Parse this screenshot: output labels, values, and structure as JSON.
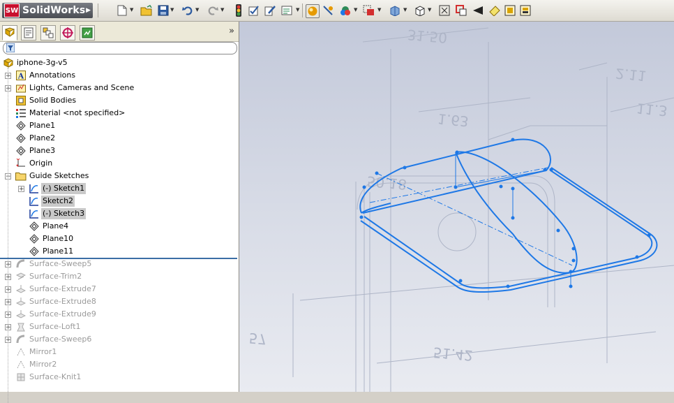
{
  "app": {
    "title": "SolidWorks",
    "logo_mark": "SW"
  },
  "toolbar": {
    "items": [
      "new-document-icon",
      "open-icon",
      "save-icon",
      "undo-icon",
      "redo-icon",
      "rebuild-icon",
      "options-icon",
      "edit-appearance-icon",
      "shaded-icon",
      "view-icon",
      "apply-scene-icon",
      "hide-show-icon",
      "section-view-icon",
      "view-orientation-icon",
      "zoom-to-fit-icon",
      "zoom-to-area-icon",
      "previous-view-icon",
      "edit-sketch-icon",
      "display-style-icon",
      "hide-items-icon"
    ]
  },
  "feature_manager": {
    "tabs": [
      "featuremanager-tab",
      "propertymanager-tab",
      "configurationmanager-tab",
      "dimxpert-tab",
      "display-manager-tab"
    ],
    "collapse": "»",
    "filter_placeholder": "",
    "tree": [
      {
        "label": "iphone-3g-v5",
        "icon": "part-icon",
        "indent": 0,
        "expand": false
      },
      {
        "label": "Annotations",
        "icon": "annotations-icon",
        "indent": 1,
        "expand": true
      },
      {
        "label": "Lights, Cameras and Scene",
        "icon": "lights-icon",
        "indent": 1,
        "expand": true
      },
      {
        "label": "Solid Bodies",
        "icon": "solid-bodies-icon",
        "indent": 1,
        "expand": false
      },
      {
        "label": "Material <not specified>",
        "icon": "material-icon",
        "indent": 1,
        "expand": false
      },
      {
        "label": "Plane1",
        "icon": "plane-icon",
        "indent": 1,
        "expand": false
      },
      {
        "label": "Plane2",
        "icon": "plane-icon",
        "indent": 1,
        "expand": false
      },
      {
        "label": "Plane3",
        "icon": "plane-icon",
        "indent": 1,
        "expand": false
      },
      {
        "label": "Origin",
        "icon": "origin-icon",
        "indent": 1,
        "expand": false
      },
      {
        "label": "Guide Sketches",
        "icon": "folder-icon",
        "indent": 1,
        "expand": "minus"
      },
      {
        "label": "(-) Sketch1",
        "icon": "sketch-icon",
        "indent": 2,
        "expand": true,
        "selected": true
      },
      {
        "label": "Sketch2",
        "icon": "sketch-icon",
        "indent": 2,
        "expand": false,
        "selected": true
      },
      {
        "label": "(-) Sketch3",
        "icon": "sketch-icon",
        "indent": 2,
        "expand": false,
        "selected": true
      },
      {
        "label": "Plane4",
        "icon": "plane-icon",
        "indent": 2,
        "expand": false
      },
      {
        "label": "Plane10",
        "icon": "plane-icon",
        "indent": 2,
        "expand": false
      },
      {
        "label": "Plane11",
        "icon": "plane-icon",
        "indent": 2,
        "expand": false
      },
      {
        "label": "Surface-Sweep5",
        "icon": "surface-sweep-icon",
        "indent": 1,
        "expand": true,
        "suppressed": true
      },
      {
        "label": "Surface-Trim2",
        "icon": "surface-trim-icon",
        "indent": 1,
        "expand": true,
        "suppressed": true
      },
      {
        "label": "Surface-Extrude7",
        "icon": "surface-extrude-icon",
        "indent": 1,
        "expand": true,
        "suppressed": true
      },
      {
        "label": "Surface-Extrude8",
        "icon": "surface-extrude-icon",
        "indent": 1,
        "expand": true,
        "suppressed": true
      },
      {
        "label": "Surface-Extrude9",
        "icon": "surface-extrude-icon",
        "indent": 1,
        "expand": true,
        "suppressed": true
      },
      {
        "label": "Surface-Loft1",
        "icon": "surface-loft-icon",
        "indent": 1,
        "expand": true,
        "suppressed": true
      },
      {
        "label": "Surface-Sweep6",
        "icon": "surface-sweep-icon",
        "indent": 1,
        "expand": true,
        "suppressed": true
      },
      {
        "label": "Mirror1",
        "icon": "mirror-icon",
        "indent": 1,
        "expand": false,
        "suppressed": true
      },
      {
        "label": "Mirror2",
        "icon": "mirror-icon",
        "indent": 1,
        "expand": false,
        "suppressed": true
      },
      {
        "label": "Surface-Knit1",
        "icon": "surface-knit-icon",
        "indent": 1,
        "expand": false,
        "suppressed": true
      }
    ]
  },
  "viewport": {
    "dimension_labels": [
      "31.50",
      "1.63",
      "2.11",
      "11.3",
      "50.18",
      "51.42",
      "57"
    ],
    "sketch_color": "#1e78e6",
    "background_top": "#c3c9da",
    "background_bottom": "#e9ebf1"
  }
}
